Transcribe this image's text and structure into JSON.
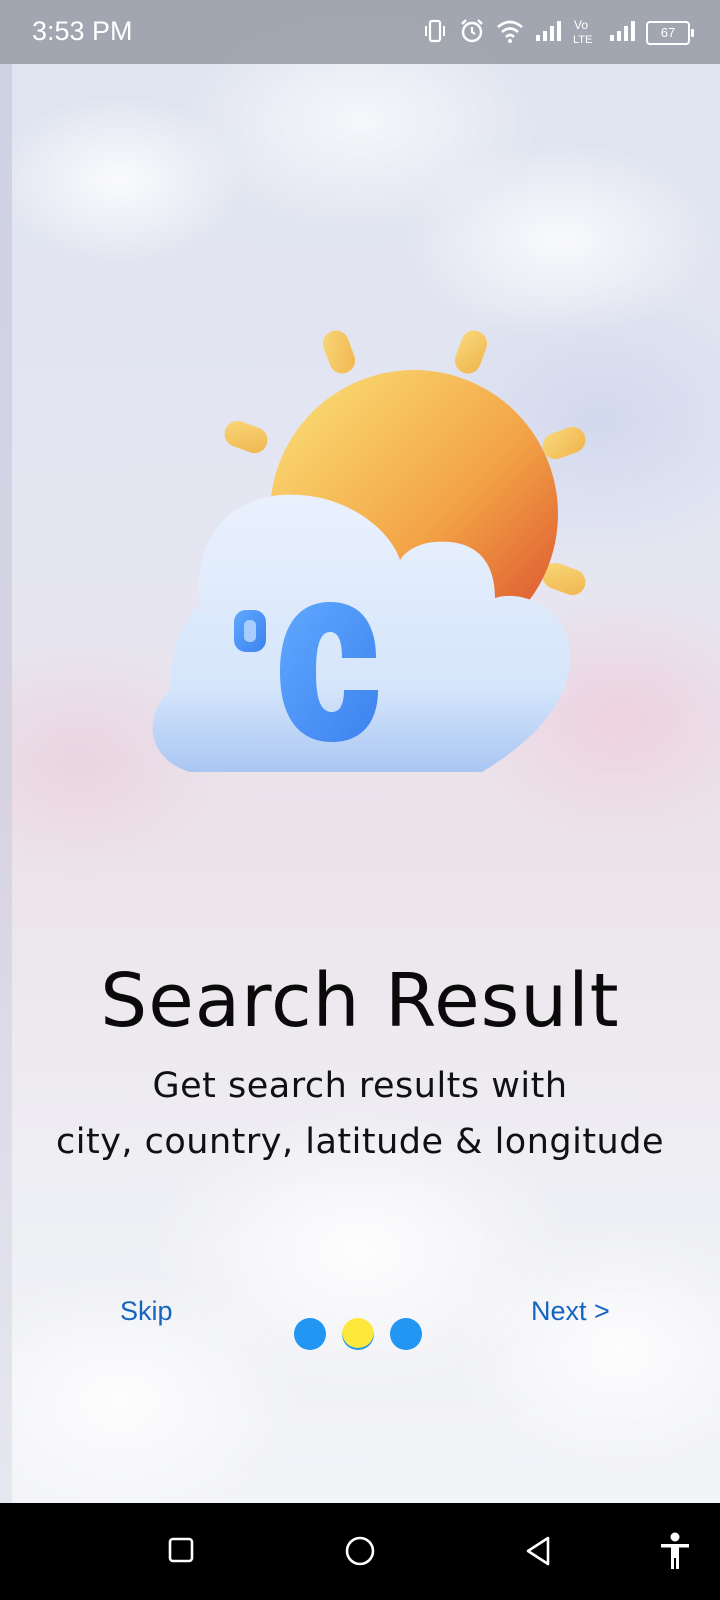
{
  "status_bar": {
    "time": "3:53 PM",
    "battery": "67",
    "icons": [
      "vibrate-icon",
      "alarm-icon",
      "wifi-icon",
      "signal-icon",
      "volte-icon",
      "signal-icon",
      "battery-icon"
    ]
  },
  "onboarding": {
    "title": "Search Result",
    "subtitle_line1": "Get search results with",
    "subtitle_line2": "city, country, latitude & longitude",
    "illustration": "sun-cloud-celsius-icon"
  },
  "controls": {
    "skip_label": "Skip",
    "next_label": "Next >",
    "page_count": 3,
    "active_page": 2
  },
  "colors": {
    "accent": "#1565c0",
    "dot": "#2196f3",
    "dot_active": "#fde93b"
  },
  "nav_bar": {
    "buttons": [
      "recents-button",
      "home-button",
      "back-button",
      "accessibility-button"
    ]
  }
}
